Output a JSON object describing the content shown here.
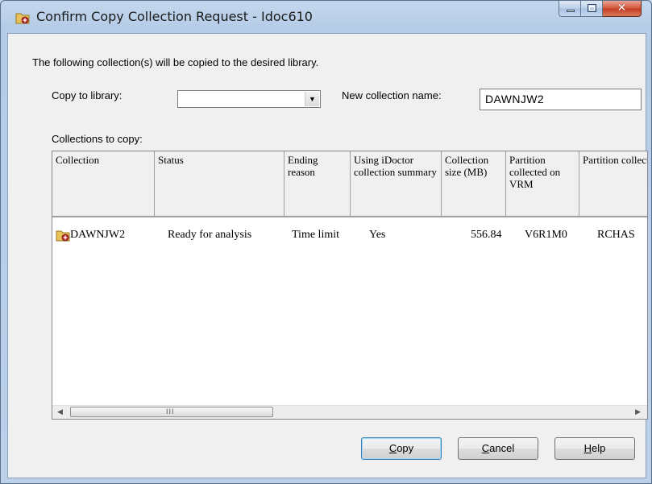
{
  "window": {
    "title": "Confirm Copy Collection Request - Idoc610",
    "icon": "idoctor-folder-icon"
  },
  "intro_text": "The following collection(s) will be copied to the desired library.",
  "copy_to_library": {
    "label": "Copy to library:",
    "value": ""
  },
  "new_collection_name": {
    "label": "New collection name:",
    "value": "DAWNJW2"
  },
  "collections_label": "Collections to copy:",
  "table": {
    "columns": [
      "Collection",
      "Status",
      "Ending reason",
      "Using iDoctor collection summary",
      "Collection size (MB)",
      "Partition collected on VRM",
      "Partition collected on"
    ],
    "rows": [
      {
        "collection": "DAWNJW2",
        "status": "Ready for analysis",
        "ending_reason": "Time limit",
        "using_summary": "Yes",
        "size_mb": "556.84",
        "vrm": "V6R1M0",
        "collected_on": "RCHAS"
      }
    ],
    "scrollbar_grip": "III"
  },
  "buttons": {
    "copy": {
      "accel": "C",
      "rest": "opy"
    },
    "cancel": {
      "accel": "C",
      "rest": "ancel"
    },
    "help": {
      "accel": "H",
      "rest": "elp"
    }
  }
}
